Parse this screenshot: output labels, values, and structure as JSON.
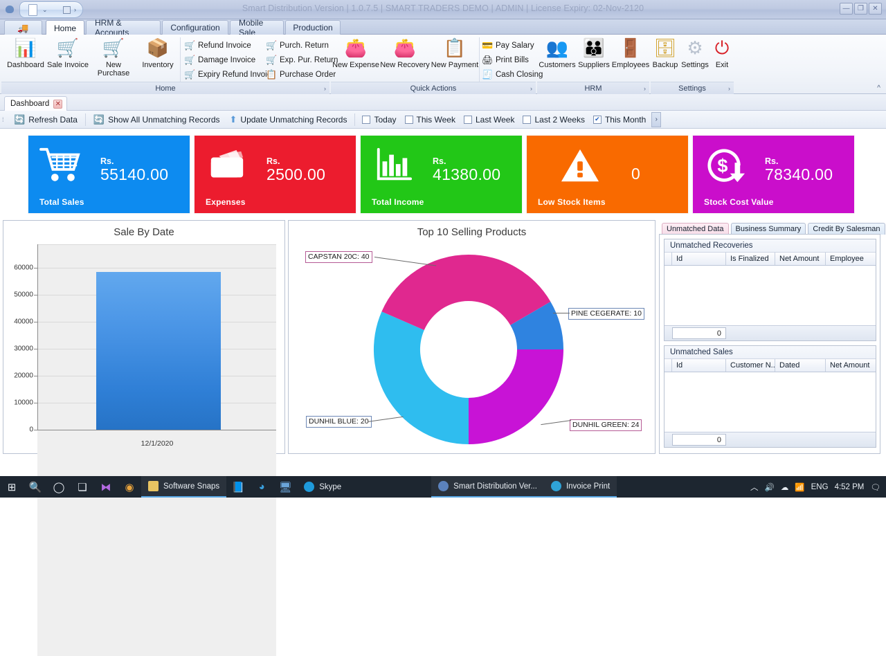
{
  "window": {
    "title": "Smart Distribution Version | 1.0.7.5 | SMART TRADERS DEMO | ADMIN | License Expiry: 02-Nov-2120",
    "minimize": "—",
    "maximize": "❐",
    "close": "✕"
  },
  "ribbon": {
    "tabs": [
      {
        "label": "",
        "icon": "truck-icon"
      },
      {
        "label": "Home"
      },
      {
        "label": "HRM & Accounts"
      },
      {
        "label": "Configuration"
      },
      {
        "label": "Mobile Sale"
      },
      {
        "label": "Production"
      }
    ],
    "groups": [
      {
        "title": "Home",
        "big": [
          {
            "label": "Dashboard",
            "icon": "bar-chart-icon"
          },
          {
            "label": "Sale Invoice",
            "icon": "shopping-cart-icon"
          },
          {
            "label": "New Purchase",
            "icon": "cart-plus-icon"
          },
          {
            "label": "Inventory",
            "icon": "boxes-icon"
          }
        ],
        "small_col1": [
          {
            "label": "Refund Invoice",
            "icon": "cart-red-icon"
          },
          {
            "label": "Damage Invoice",
            "icon": "cart-red-icon"
          },
          {
            "label": "Expiry Refund Invoice",
            "icon": "cart-red-icon"
          }
        ],
        "small_col2": [
          {
            "label": "Purch. Return",
            "icon": "cart-dark-icon"
          },
          {
            "label": "Exp. Pur. Return",
            "icon": "cart-dark-icon"
          },
          {
            "label": "Purchase Order",
            "icon": "clipboard-icon"
          }
        ]
      },
      {
        "title": "Quick Actions",
        "big": [
          {
            "label": "New Expense",
            "icon": "wallet-icon"
          },
          {
            "label": "New Recovery",
            "icon": "wallet-return-icon"
          },
          {
            "label": "New Payment",
            "icon": "clipboard-check-icon"
          }
        ],
        "small_col1": [
          {
            "label": "Pay Salary",
            "icon": "money-icon"
          },
          {
            "label": "Print Bills",
            "icon": "printer-icon"
          },
          {
            "label": "Cash Closing",
            "icon": "cash-close-icon"
          }
        ]
      },
      {
        "title": "HRM",
        "big": [
          {
            "label": "Customers",
            "icon": "customers-icon"
          },
          {
            "label": "Suppliers",
            "icon": "suppliers-icon"
          },
          {
            "label": "Employees",
            "icon": "employee-door-icon"
          }
        ]
      },
      {
        "title": "Settings",
        "big": [
          {
            "label": "Backup",
            "icon": "database-backup-icon"
          },
          {
            "label": "Settings",
            "icon": "gear-icon"
          },
          {
            "label": "Exit",
            "icon": "power-icon"
          }
        ]
      }
    ],
    "collapse": "^"
  },
  "doc_tab": {
    "label": "Dashboard",
    "close": "✕"
  },
  "filterbar": {
    "buttons": [
      {
        "label": "Refresh Data",
        "icon": "refresh-icon"
      },
      {
        "label": "Show All Unmatching Records",
        "icon": "refresh-icon"
      },
      {
        "label": "Update Unmatching Records",
        "icon": "up-arrow-icon"
      }
    ],
    "checkboxes": [
      {
        "label": "Today",
        "checked": false
      },
      {
        "label": "This Week",
        "checked": false
      },
      {
        "label": "Last Week",
        "checked": false
      },
      {
        "label": "Last 2 Weeks",
        "checked": false
      },
      {
        "label": "This Month",
        "checked": true
      }
    ],
    "overflow": "›"
  },
  "kpis": [
    {
      "label": "Total Sales",
      "currency": "Rs.",
      "value": "55140.00",
      "color": "#0d8bf0",
      "icon": "shopping-cart-icon"
    },
    {
      "label": "Expenses",
      "currency": "Rs.",
      "value": "2500.00",
      "color": "#ec1c2e",
      "icon": "wallet-icon"
    },
    {
      "label": "Total Income",
      "currency": "Rs.",
      "value": "41380.00",
      "color": "#22c717",
      "icon": "bar-chart-icon"
    },
    {
      "label": "Low Stock Items",
      "currency": "",
      "value": "0",
      "color": "#f96a00",
      "icon": "warning-icon"
    },
    {
      "label": "Stock Cost Value",
      "currency": "Rs.",
      "value": "78340.00",
      "color": "#ca0ecb",
      "icon": "dollar-down-icon"
    }
  ],
  "chart_data": [
    {
      "type": "bar",
      "title": "Sale By Date",
      "categories": [
        "12/1/2020"
      ],
      "values": [
        61000
      ],
      "xlabel": "",
      "ylabel": "",
      "ylim": [
        0,
        65000
      ],
      "yticks": [
        0,
        10000,
        20000,
        30000,
        40000,
        50000,
        60000
      ],
      "grid": true,
      "legend": "none",
      "series_color": "#3b86dd"
    },
    {
      "type": "pie",
      "subtype": "donut",
      "title": "Top 10 Selling Products",
      "categories": [
        "CAPSTAN 20C",
        "PINE CEGERATE",
        "DUNHIL GREEN",
        "DUNHIL BLUE"
      ],
      "values": [
        40,
        10,
        24,
        20
      ],
      "labels": [
        "CAPSTAN 20C: 40",
        "PINE CEGERATE: 10",
        "DUNHIL GREEN: 24",
        "DUNHIL BLUE: 20"
      ],
      "colors": [
        "#e0288f",
        "#2f83e0",
        "#c813d6",
        "#2fbdef"
      ],
      "grid": false,
      "legend": "callouts"
    }
  ],
  "right_panel": {
    "tabs": [
      {
        "label": "Unmatched Data",
        "active": true
      },
      {
        "label": "Business Summary",
        "active": false
      },
      {
        "label": "Credit By Salesman",
        "active": false
      }
    ],
    "grids": [
      {
        "caption": "Unmatched Recoveries",
        "columns": [
          "Id",
          "Is Finalized",
          "Net Amount",
          "Employee"
        ],
        "rows": [],
        "footer_total": "0"
      },
      {
        "caption": "Unmatched Sales",
        "columns": [
          "Id",
          "Customer N...",
          "Dated",
          "Net Amount"
        ],
        "rows": [],
        "footer_total": "0"
      }
    ]
  },
  "taskbar": {
    "icons": [
      "start-icon",
      "search-icon",
      "cortana-icon",
      "task-view-icon",
      "vs-code-icon",
      "chrome-icon"
    ],
    "items": [
      {
        "label": "Software Snaps",
        "icon": "folder-icon",
        "open": true
      },
      {
        "label": "",
        "icon": "notepad-icon",
        "open": false
      },
      {
        "label": "",
        "icon": "edge-icon",
        "open": false
      },
      {
        "label": "",
        "icon": "remote-desktop-icon",
        "open": false
      },
      {
        "label": "Skype",
        "icon": "skype-icon",
        "open": false
      },
      {
        "label": "Smart Distribution Ver...",
        "icon": "app-icon",
        "open": true
      },
      {
        "label": "Invoice Print",
        "icon": "app-icon",
        "open": true
      }
    ],
    "tray": {
      "chevron": "︿",
      "volume": "volume-icon",
      "onedrive": "onedrive-icon",
      "network": "wifi-icon",
      "language": "ENG",
      "time": "4:52 PM",
      "notifications": "notification-icon"
    }
  }
}
